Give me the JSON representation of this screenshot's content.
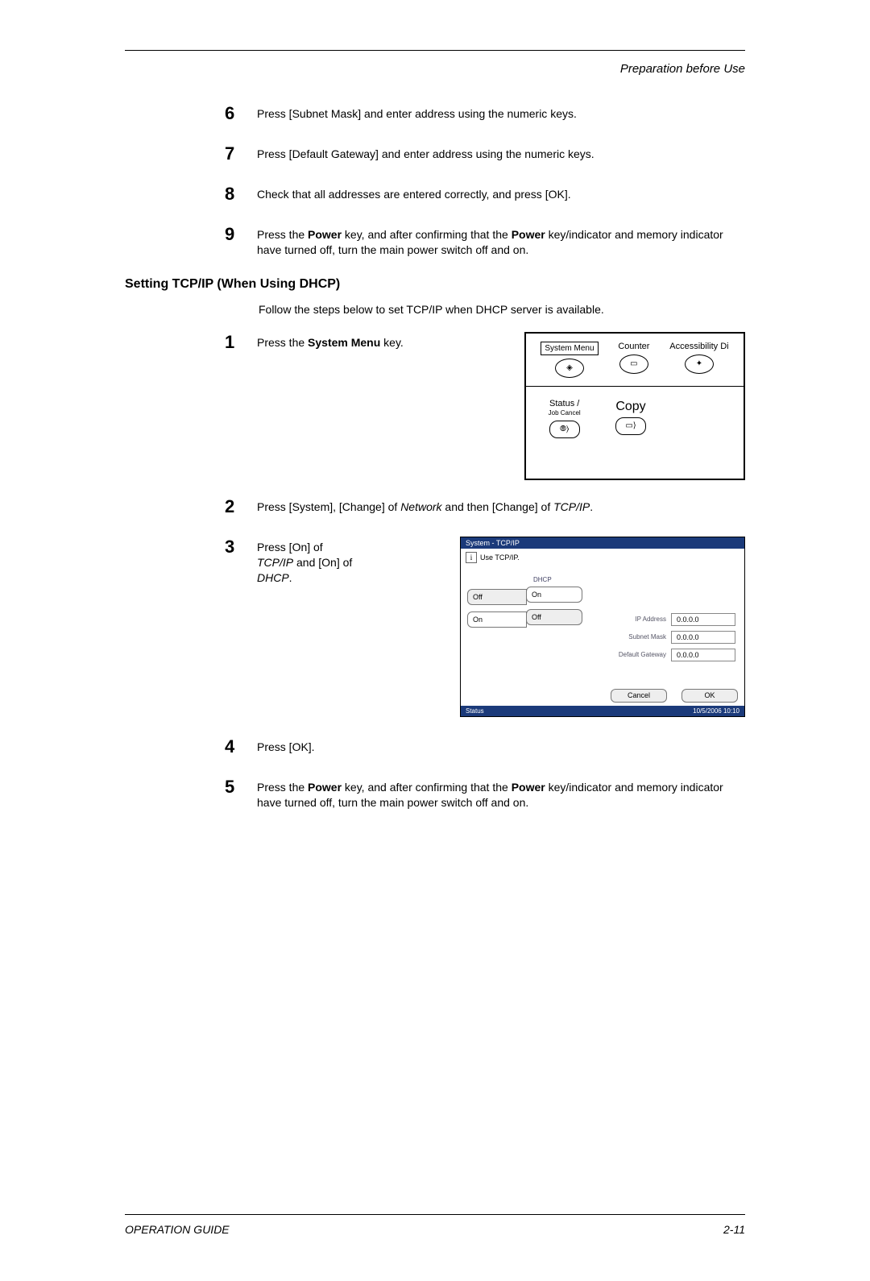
{
  "header": {
    "section": "Preparation before Use"
  },
  "top_steps": [
    {
      "n": "6",
      "html": "Press [Subnet Mask] and enter address using the numeric keys."
    },
    {
      "n": "7",
      "html": "Press [Default Gateway] and enter address using the numeric keys."
    },
    {
      "n": "8",
      "html": "Check that all addresses are entered correctly, and press [OK]."
    },
    {
      "n": "9",
      "html": "Press the <b>Power</b> key, and after confirming that the <b>Power</b> key/indicator and memory indicator have turned off, turn the main power switch off and on."
    }
  ],
  "heading": "Setting TCP/IP (When Using DHCP)",
  "intro": "Follow the steps below to set TCP/IP when DHCP server is available.",
  "dhcp_steps": {
    "s1": {
      "n": "1",
      "html": "Press the <b>System Menu</b> key."
    },
    "s2": {
      "n": "2",
      "html": "Press [System], [Change] of <i>Network</i> and then [Change] of <i>TCP/IP</i>."
    },
    "s3": {
      "n": "3",
      "html": "Press [On] of <i>TCP/IP</i> and [On] of <i>DHCP</i>."
    },
    "s4": {
      "n": "4",
      "html": "Press [OK]."
    },
    "s5": {
      "n": "5",
      "html": "Press the <b>Power</b> key, and after confirming that the <b>Power</b> key/indicator and memory indicator have turned off, turn the main power switch off and on."
    }
  },
  "panel": {
    "system_menu": "System Menu",
    "counter": "Counter",
    "accessibility": "Accessibility Di",
    "status": "Status /",
    "jobcancel": "Job Cancel",
    "copy": "Copy"
  },
  "screen": {
    "title": "System - TCP/IP",
    "subtitle": "Use TCP/IP.",
    "tcp_off": "Off",
    "tcp_on": "On",
    "dhcp_label": "DHCP",
    "dhcp_on": "On",
    "dhcp_off": "Off",
    "ip_label": "IP Address",
    "ip": "0.0.0.0",
    "subnet_label": "Subnet Mask",
    "subnet": "0.0.0.0",
    "gateway_label": "Default Gateway",
    "gateway": "0.0.0.0",
    "cancel": "Cancel",
    "ok": "OK",
    "status": "Status",
    "timestamp": "10/5/2006   10:10"
  },
  "footer": {
    "left": "OPERATION GUIDE",
    "right": "2-11"
  }
}
